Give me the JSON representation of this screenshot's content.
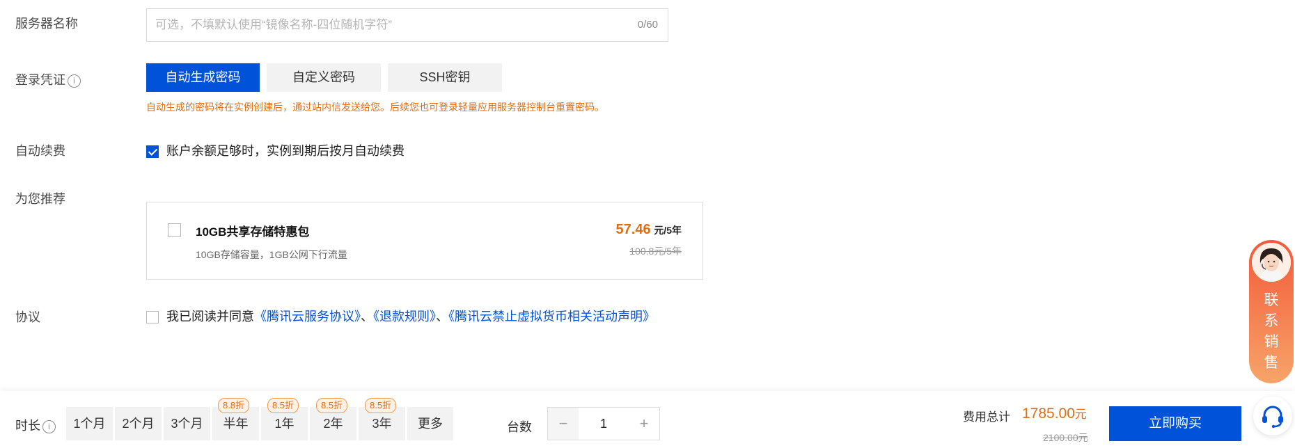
{
  "server_name": {
    "label": "服务器名称",
    "placeholder": "可选，不填默认使用“镜像名称-四位随机字符”",
    "value": "",
    "counter": "0/60"
  },
  "credential": {
    "label": "登录凭证",
    "info_icon": "info-icon",
    "options": [
      "自动生成密码",
      "自定义密码",
      "SSH密钥"
    ],
    "selected": "自动生成密码",
    "hint": "自动生成的密码将在实例创建后，通过站内信发送给您。后续您也可登录轻量应用服务器控制台重置密码。"
  },
  "auto_renew": {
    "label": "自动续费",
    "checked": true,
    "text": "账户余额足够时，实例到期后按月自动续费"
  },
  "recommend": {
    "label": "为您推荐",
    "card": {
      "checked": false,
      "title": "10GB共享存储特惠包",
      "desc": "10GB存储容量，1GB公网下行流量",
      "price": "57.46",
      "price_unit": "元/5年",
      "old_price": "100.8元/5年"
    }
  },
  "agreement": {
    "label": "协议",
    "checked": false,
    "prefix": "我已阅读并同意",
    "links": [
      "《腾讯云服务协议》",
      "《退款规则》",
      "《腾讯云禁止虚拟货币相关活动声明》"
    ],
    "separator": "、"
  },
  "bottom": {
    "duration_label": "时长",
    "durations": [
      {
        "label": "1个月",
        "badge": ""
      },
      {
        "label": "2个月",
        "badge": ""
      },
      {
        "label": "3个月",
        "badge": ""
      },
      {
        "label": "半年",
        "badge": "8.8折"
      },
      {
        "label": "1年",
        "badge": "8.5折"
      },
      {
        "label": "2年",
        "badge": "8.5折"
      },
      {
        "label": "3年",
        "badge": "8.5折"
      },
      {
        "label": "更多",
        "badge": ""
      }
    ],
    "count_label": "台数",
    "count": "1",
    "minus": "−",
    "plus": "+",
    "total_label": "费用总计",
    "total": "1785.00",
    "total_unit": "元",
    "old_total": "2100.00元",
    "buy_label": "立即购买"
  },
  "contact_sales": {
    "chars": [
      "联",
      "系",
      "销",
      "售"
    ]
  },
  "colors": {
    "primary": "#0052d9",
    "accent_orange": "#e26d12"
  }
}
